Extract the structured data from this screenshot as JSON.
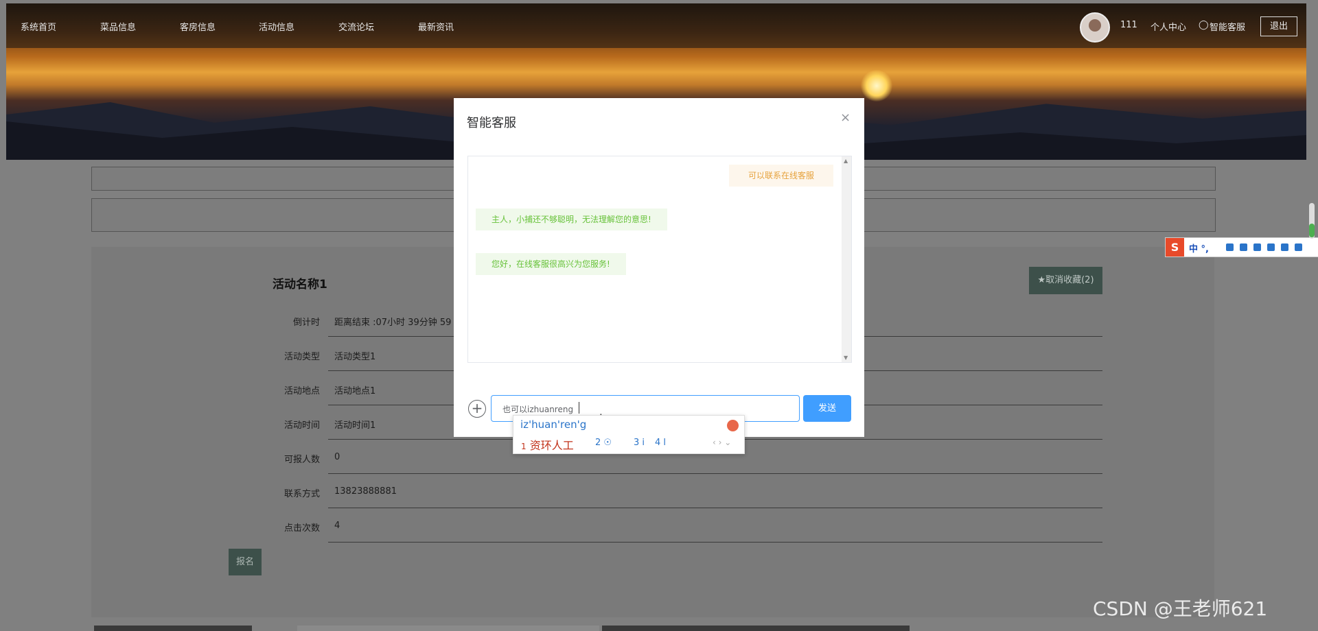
{
  "nav": {
    "links": [
      "系统首页",
      "菜品信息",
      "客房信息",
      "活动信息",
      "交流论坛",
      "最新资讯"
    ],
    "username": "111",
    "profile_label": "个人中心",
    "service_label": "智能客服",
    "logout_label": "退出"
  },
  "detail": {
    "title": "活动名称1",
    "fav_button": "★取消收藏(2)",
    "rows": [
      {
        "label": "倒计时",
        "value": "距离结束 :07小时 39分钟 59"
      },
      {
        "label": "活动类型",
        "value": "活动类型1"
      },
      {
        "label": "活动地点",
        "value": "活动地点1"
      },
      {
        "label": "活动时间",
        "value": "活动时间1"
      },
      {
        "label": "可报人数",
        "value": "0"
      },
      {
        "label": "联系方式",
        "value": "13823888881"
      },
      {
        "label": "点击次数",
        "value": "4"
      }
    ],
    "signup_button": "报名"
  },
  "modal": {
    "title": "智能客服",
    "close": "×",
    "messages": [
      {
        "side": "right",
        "text": "可以联系在线客服"
      },
      {
        "side": "left",
        "text": "主人，小捕还不够聪明，无法理解您的意思!"
      },
      {
        "side": "left",
        "text": "您好，在线客服很高兴为您服务!"
      }
    ],
    "input_value": "也可以izhuanreng",
    "send_label": "发送"
  },
  "ime": {
    "pinyin": "iz'huan'ren'g",
    "candidate1": "资环人工",
    "candidate1_num": "1",
    "candidate2_num": "2",
    "candidate3": "3 i",
    "candidate4": "4 l",
    "bar_label": "中 °,"
  },
  "watermark": "CSDN @王老师621"
}
